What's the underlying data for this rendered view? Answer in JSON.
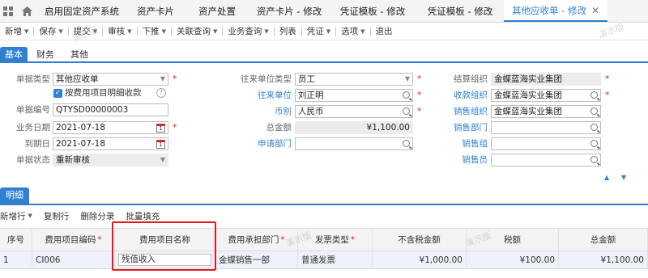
{
  "tabs": [
    {
      "label": "启用固定资产系统"
    },
    {
      "label": "资产卡片"
    },
    {
      "label": "资产处置"
    },
    {
      "label": "资产卡片 - 修改"
    },
    {
      "label": "凭证模板 - 修改"
    },
    {
      "label": "凭证模板 - 修改"
    },
    {
      "label": "其他应收单 - 修改"
    }
  ],
  "toolbar": {
    "new": "新增",
    "save": "保存",
    "submit": "提交",
    "audit": "审核",
    "push": "下推",
    "related": "关联查询",
    "business": "业务查询",
    "list": "列表",
    "voucher": "凭证",
    "options": "选项",
    "exit": "退出"
  },
  "section_tabs": [
    "基本",
    "财务",
    "其他"
  ],
  "form": {
    "bill_type": {
      "label": "单据类型",
      "value": "其他应收单"
    },
    "by_expense": {
      "label": "按费用项目明细收款"
    },
    "bill_no": {
      "label": "单据编号",
      "value": "QTYSD00000003"
    },
    "biz_date": {
      "label": "业务日期",
      "value": "2021-07-18"
    },
    "due_date": {
      "label": "到期日",
      "value": "2021-07-18"
    },
    "status": {
      "label": "单据状态",
      "value": "重新审核"
    },
    "contact_type": {
      "label": "往来单位类型",
      "value": "员工"
    },
    "contact": {
      "label": "往来单位",
      "value": "刘正明"
    },
    "currency": {
      "label": "币别",
      "value": "人民币"
    },
    "total": {
      "label": "总金额",
      "value": "¥1,100.00"
    },
    "apply_dept": {
      "label": "申请部门",
      "value": ""
    },
    "settle_org": {
      "label": "结算组织",
      "value": "金蝶蓝海实业集团"
    },
    "receive_org": {
      "label": "收款组织",
      "value": "金蝶蓝海实业集团"
    },
    "sales_org": {
      "label": "销售组织",
      "value": "金蝶蓝海实业集团"
    },
    "sales_dept": {
      "label": "销售部门",
      "value": ""
    },
    "sales_group": {
      "label": "销售组",
      "value": ""
    },
    "salesman": {
      "label": "销售员",
      "value": ""
    }
  },
  "detail": {
    "tab": "明细",
    "toolbar": {
      "add_row": "新增行",
      "copy_row": "复制行",
      "delete_entry": "删除分录",
      "batch_fill": "批量填充"
    },
    "columns": [
      "序号",
      "费用项目编码",
      "费用项目名称",
      "费用承担部门",
      "发票类型",
      "不含税金额",
      "税额",
      "总金额"
    ],
    "rows": [
      {
        "seq": "1",
        "code": "CI006",
        "name": "残值收入",
        "dept": "金蝶销售一部",
        "invoice": "普通发票",
        "net": "¥1,000.00",
        "tax": "¥100.00",
        "total": "¥1,100.00"
      }
    ]
  },
  "watermark": "演示版",
  "colors": {
    "accent": "#2f80d1",
    "required": "#d9262c",
    "highlight": "#e11a22"
  }
}
